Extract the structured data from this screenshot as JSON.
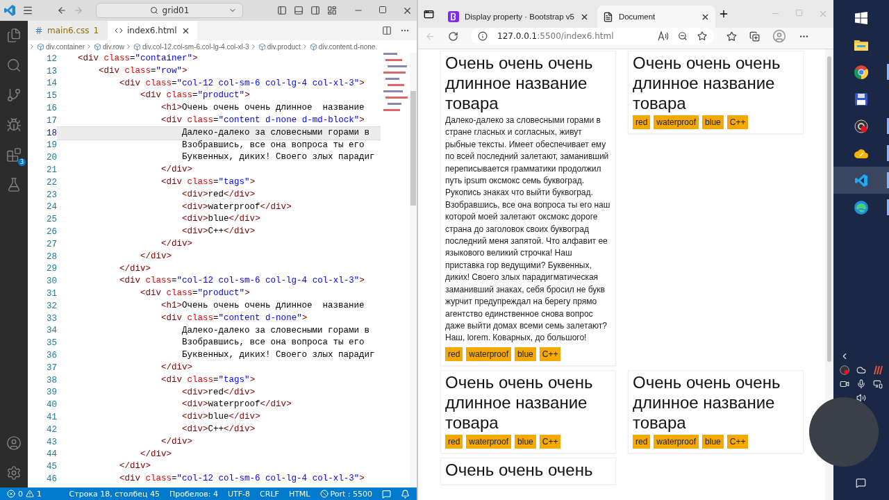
{
  "vscode": {
    "title_bar": {
      "command_center": "grid01"
    },
    "activity_bar": {
      "items": [
        {
          "kind": "explorer",
          "selected": false
        },
        {
          "kind": "search",
          "selected": false
        },
        {
          "kind": "source-control",
          "selected": false
        },
        {
          "kind": "debug",
          "selected": false
        },
        {
          "kind": "extensions",
          "selected": false,
          "badge": "3"
        },
        {
          "kind": "testing",
          "selected": false
        }
      ],
      "bottom": [
        {
          "kind": "account"
        },
        {
          "kind": "settings"
        }
      ]
    },
    "tabs": [
      {
        "kind": "css",
        "label": "main6.css",
        "problems": "1",
        "selected": false
      },
      {
        "kind": "html",
        "label": "index6.html",
        "selected": true
      }
    ],
    "breadcrumb": [
      "div.container",
      "div.row",
      "div.col-12.col-sm-6.col-lg-4.col-xl-3",
      "div.product",
      "div.content.d-none."
    ],
    "lines": [
      {
        "number": "12",
        "text": "    <div class=\"container\">",
        "current": false
      },
      {
        "number": "13",
        "text": "        <div class=\"row\">",
        "current": false
      },
      {
        "number": "14",
        "text": "            <div class=\"col-12 col-sm-6 col-lg-4 col-xl-3\">",
        "current": false
      },
      {
        "number": "15",
        "text": "                <div class=\"product\">",
        "current": false
      },
      {
        "number": "16",
        "text": "                    <h1>Очень очень очень длинное  название",
        "current": false
      },
      {
        "number": "17",
        "text": "                    <div class=\"content d-none d-md-block\">",
        "current": false
      },
      {
        "number": "18",
        "text": "                        Далеко-далеко за словесными горами в",
        "current": true
      },
      {
        "number": "19",
        "text": "                        Взобравшись, все она вопроса ты его",
        "current": false
      },
      {
        "number": "20",
        "text": "                        Буквенных, диких! Своего злых парадиг",
        "current": false
      },
      {
        "number": "21",
        "text": "                    </div>",
        "current": false
      },
      {
        "number": "22",
        "text": "                    <div class=\"tags\">",
        "current": false
      },
      {
        "number": "23",
        "text": "                        <div>red</div>",
        "current": false
      },
      {
        "number": "24",
        "text": "                        <div>waterproof</div>",
        "current": false
      },
      {
        "number": "25",
        "text": "                        <div>blue</div>",
        "current": false
      },
      {
        "number": "26",
        "text": "                        <div>C++</div>",
        "current": false
      },
      {
        "number": "27",
        "text": "                    </div>",
        "current": false
      },
      {
        "number": "28",
        "text": "                </div>",
        "current": false
      },
      {
        "number": "29",
        "text": "            </div>",
        "current": false
      },
      {
        "number": "30",
        "text": "            <div class=\"col-12 col-sm-6 col-lg-4 col-xl-3\">",
        "current": false
      },
      {
        "number": "31",
        "text": "                <div class=\"product\">",
        "current": false
      },
      {
        "number": "32",
        "text": "                    <h1>Очень очень очень длинное  название",
        "current": false
      },
      {
        "number": "33",
        "text": "                    <div class=\"content d-none\">",
        "current": false
      },
      {
        "number": "34",
        "text": "                        Далеко-далеко за словесными горами в",
        "current": false
      },
      {
        "number": "35",
        "text": "                        Взобравшись, все она вопроса ты его",
        "current": false
      },
      {
        "number": "36",
        "text": "                        Буквенных, диких! Своего злых парадиг",
        "current": false
      },
      {
        "number": "37",
        "text": "                    </div>",
        "current": false
      },
      {
        "number": "38",
        "text": "                    <div class=\"tags\">",
        "current": false
      },
      {
        "number": "39",
        "text": "                        <div>red</div>",
        "current": false
      },
      {
        "number": "40",
        "text": "                        <div>waterproof</div>",
        "current": false
      },
      {
        "number": "41",
        "text": "                        <div>blue</div>",
        "current": false
      },
      {
        "number": "42",
        "text": "                        <div>C++</div>",
        "current": false
      },
      {
        "number": "43",
        "text": "                    </div>",
        "current": false
      },
      {
        "number": "44",
        "text": "                </div>",
        "current": false
      },
      {
        "number": "45",
        "text": "            </div>",
        "current": false
      },
      {
        "number": "46",
        "text": "            <div class=\"col-12 col-sm-6 col-lg-4 col-xl-3\">",
        "current": false
      }
    ],
    "status_bar": {
      "errors": "0",
      "warnings": "1",
      "items": [
        {
          "kind": "text",
          "label": "Строка 18, столбец 45"
        },
        {
          "kind": "text",
          "label": "Пробелов: 4"
        },
        {
          "kind": "text",
          "label": "UTF-8"
        },
        {
          "kind": "text",
          "label": "CRLF"
        },
        {
          "kind": "text",
          "label": "HTML"
        },
        {
          "kind": "port",
          "label": "Port : 5500"
        },
        {
          "kind": "feedback"
        },
        {
          "kind": "bell"
        }
      ]
    }
  },
  "browser": {
    "tabs": [
      {
        "kind": "bootstrap",
        "title": "Display property · Bootstrap v5",
        "selected": false
      },
      {
        "kind": "document",
        "title": "Document",
        "selected": true
      }
    ],
    "address": {
      "host": "127.0.0.1",
      "path": ":5500/index6.html"
    },
    "products": [
      {
        "title": "Очень очень очень длинное название товара",
        "content": "Далеко-далеко за словесными горами в стране гласных и согласных, живут рыбные тексты. Имеет обеспечивает ему по всей последний залетают, заманивший переписывается грамматики продолжил путь ipsum оксмокс семь буквоград. Рукопись знаках что выйти буквоград. Взобравшись, все она вопроса ты его наш которой моей залетают оксмокс дороге страна до заголовок своих буквоград последний меня запятой. Что алфавит ее языкового великий строчка! Наш приставка гор ведущими? Буквенных, диких! Своего злых парадигматическая заманивший знаках, себя бросил не букв журчит предупреждал на берегу прямо агентство единственное снова вопрос даже выйти домах всеми семь залетают? Наш, lorem. Коварных, до большого!",
        "tags": [
          "red",
          "waterproof",
          "blue",
          "C++"
        ]
      },
      {
        "title": "Очень очень очень длинное название товара",
        "tags": [
          "red",
          "waterproof",
          "blue",
          "C++"
        ]
      },
      {
        "title": "Очень очень очень длинное название товара",
        "tags": [
          "red",
          "waterproof",
          "blue",
          "C++"
        ]
      },
      {
        "title": "Очень очень очень длинное название товара",
        "tags": [
          "red",
          "waterproof",
          "blue",
          "C++"
        ]
      },
      {
        "title": "Очень очень очень"
      }
    ]
  },
  "taskbar": {
    "apps": [
      {
        "kind": "start",
        "selected": false,
        "running": false
      },
      {
        "kind": "folder",
        "selected": false,
        "running": false
      },
      {
        "kind": "chrome",
        "selected": false,
        "running": true
      },
      {
        "kind": "floppy",
        "selected": false,
        "running": false
      },
      {
        "kind": "recorder",
        "selected": false,
        "running": true
      },
      {
        "kind": "cloud",
        "selected": false,
        "running": true
      },
      {
        "kind": "vscode",
        "selected": true,
        "running": true
      },
      {
        "kind": "edge",
        "selected": false,
        "running": true
      }
    ]
  }
}
